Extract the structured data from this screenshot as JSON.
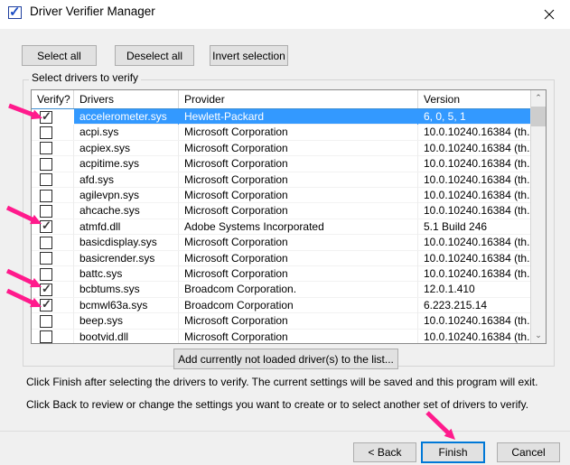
{
  "window": {
    "title": "Driver Verifier Manager",
    "icon": "verifier-checkbox-icon",
    "close_label": "✕"
  },
  "toolbar": {
    "select_all": "Select all",
    "deselect_all": "Deselect all",
    "invert_selection": "Invert selection"
  },
  "group": {
    "legend": "Select drivers to verify"
  },
  "list": {
    "columns": [
      "Verify?",
      "Drivers",
      "Provider",
      "Version"
    ],
    "rows": [
      {
        "checked": true,
        "driver": "accelerometer.sys",
        "provider": "Hewlett-Packard",
        "version": "6, 0, 5, 1",
        "selected": true
      },
      {
        "checked": false,
        "driver": "acpi.sys",
        "provider": "Microsoft Corporation",
        "version": "10.0.10240.16384 (th...",
        "selected": false
      },
      {
        "checked": false,
        "driver": "acpiex.sys",
        "provider": "Microsoft Corporation",
        "version": "10.0.10240.16384 (th...",
        "selected": false
      },
      {
        "checked": false,
        "driver": "acpitime.sys",
        "provider": "Microsoft Corporation",
        "version": "10.0.10240.16384 (th...",
        "selected": false
      },
      {
        "checked": false,
        "driver": "afd.sys",
        "provider": "Microsoft Corporation",
        "version": "10.0.10240.16384 (th...",
        "selected": false
      },
      {
        "checked": false,
        "driver": "agilevpn.sys",
        "provider": "Microsoft Corporation",
        "version": "10.0.10240.16384 (th...",
        "selected": false
      },
      {
        "checked": false,
        "driver": "ahcache.sys",
        "provider": "Microsoft Corporation",
        "version": "10.0.10240.16384 (th...",
        "selected": false
      },
      {
        "checked": true,
        "driver": "atmfd.dll",
        "provider": "Adobe Systems Incorporated",
        "version": "5.1 Build 246",
        "selected": false
      },
      {
        "checked": false,
        "driver": "basicdisplay.sys",
        "provider": "Microsoft Corporation",
        "version": "10.0.10240.16384 (th...",
        "selected": false
      },
      {
        "checked": false,
        "driver": "basicrender.sys",
        "provider": "Microsoft Corporation",
        "version": "10.0.10240.16384 (th...",
        "selected": false
      },
      {
        "checked": false,
        "driver": "battc.sys",
        "provider": "Microsoft Corporation",
        "version": "10.0.10240.16384 (th...",
        "selected": false
      },
      {
        "checked": true,
        "driver": "bcbtums.sys",
        "provider": "Broadcom Corporation.",
        "version": "12.0.1.410",
        "selected": false
      },
      {
        "checked": true,
        "driver": "bcmwl63a.sys",
        "provider": "Broadcom Corporation",
        "version": "6.223.215.14",
        "selected": false
      },
      {
        "checked": false,
        "driver": "beep.sys",
        "provider": "Microsoft Corporation",
        "version": "10.0.10240.16384 (th...",
        "selected": false
      },
      {
        "checked": false,
        "driver": "bootvid.dll",
        "provider": "Microsoft Corporation",
        "version": "10.0.10240.16384 (th...",
        "selected": false
      }
    ],
    "scrollbar": {
      "up": "⌃",
      "down": "⌄"
    }
  },
  "actions": {
    "add_drivers": "Add currently not loaded driver(s) to the list..."
  },
  "instructions": {
    "line1": "Click Finish after selecting the drivers to verify. The current settings will be saved and this program will exit.",
    "line2": "Click Back to review or change the settings you want to create or to select another set of drivers to verify."
  },
  "footer": {
    "back": "< Back",
    "finish": "Finish",
    "cancel": "Cancel"
  },
  "annotations": {
    "color": "#ff1a8c",
    "arrows": [
      {
        "name": "arrow-to-accelerometer-checkbox"
      },
      {
        "name": "arrow-to-atmfd-checkbox"
      },
      {
        "name": "arrow-to-bcbtums-checkbox"
      },
      {
        "name": "arrow-to-bcmwl63a-checkbox"
      },
      {
        "name": "arrow-to-finish-button"
      }
    ]
  },
  "colors": {
    "selection_blue": "#3399ff",
    "focus_blue": "#0078d7",
    "annotation_pink": "#ff1a8c"
  }
}
